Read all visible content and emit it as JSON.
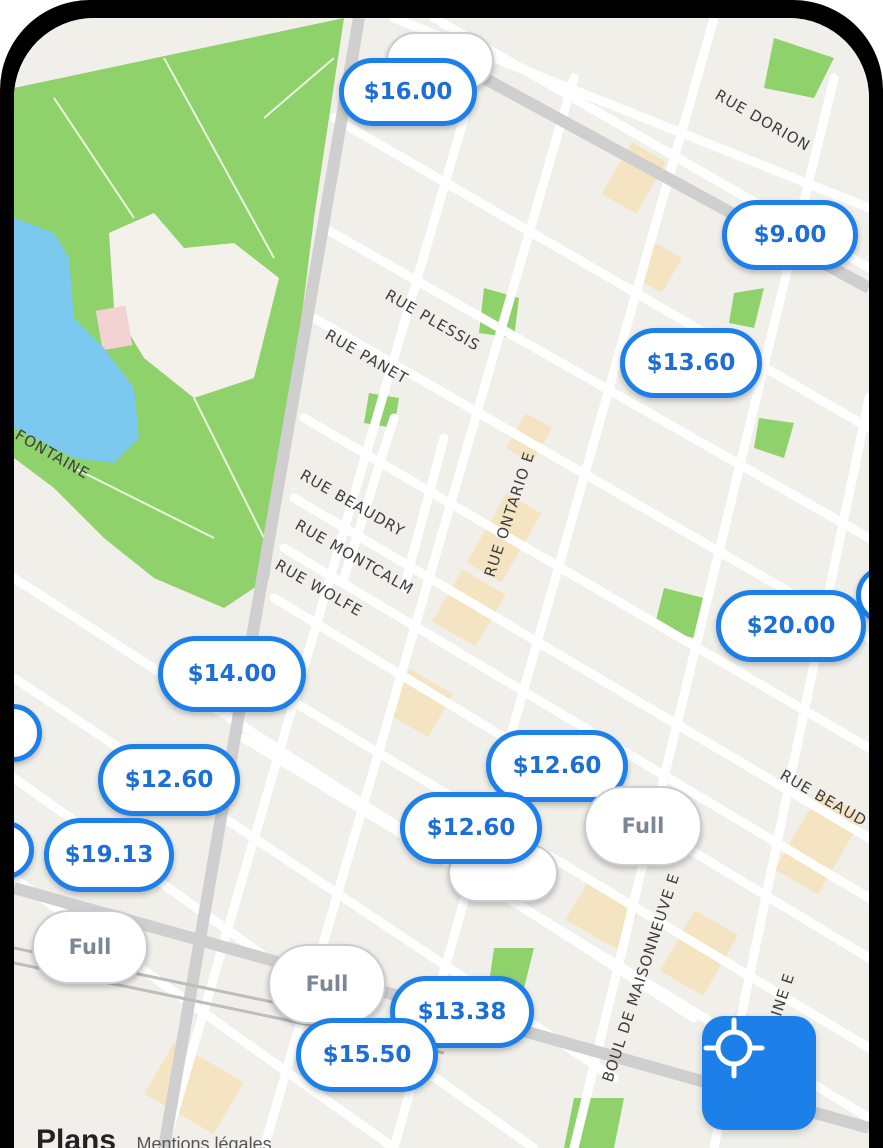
{
  "map": {
    "streets": [
      {
        "id": "rue-dorion",
        "label": "RUE DORION"
      },
      {
        "id": "rue-plessis",
        "label": "RUE PLESSIS"
      },
      {
        "id": "rue-panet",
        "label": "RUE PANET"
      },
      {
        "id": "fontaine",
        "label": "FONTAINE"
      },
      {
        "id": "rue-beaudry",
        "label": "RUE BEAUDRY"
      },
      {
        "id": "rue-montcalm",
        "label": "RUE MONTCALM"
      },
      {
        "id": "rue-wolfe",
        "label": "RUE WOLFE"
      },
      {
        "id": "rue-ontario",
        "label": "RUE ONTARIO E"
      },
      {
        "id": "rue-beaudry-right",
        "label": "RUE BEAUD"
      },
      {
        "id": "boul-maisonneuve",
        "label": "BOUL DE MAISONNEUVE E"
      },
      {
        "id": "sainte-catherine",
        "label": "ERINE E"
      }
    ],
    "price_pins": [
      {
        "label": "$16.00",
        "status": "available"
      },
      {
        "label": "$9.00",
        "status": "available"
      },
      {
        "label": "$13.60",
        "status": "available"
      },
      {
        "label": "$20.00",
        "status": "available"
      },
      {
        "label": "$14.00",
        "status": "available"
      },
      {
        "label": "$12.60",
        "status": "available"
      },
      {
        "label": "$12.60",
        "status": "available"
      },
      {
        "label": "$12.60",
        "status": "available"
      },
      {
        "label": "$19.13",
        "status": "available"
      },
      {
        "label": "Full",
        "status": "full"
      },
      {
        "label": "Full",
        "status": "full"
      },
      {
        "label": "Full",
        "status": "full"
      },
      {
        "label": "$13.38",
        "status": "available"
      },
      {
        "label": "$15.50",
        "status": "available"
      }
    ],
    "attribution": {
      "brand": "Plans",
      "legal": "Mentions légales"
    },
    "colors": {
      "accent": "#1d7fe8",
      "park": "#8fd16a",
      "water": "#7cc9ef",
      "land": "#f1efea",
      "commercial": "#f7e3bd"
    }
  },
  "controls": {
    "locate_icon": "crosshair-icon"
  }
}
